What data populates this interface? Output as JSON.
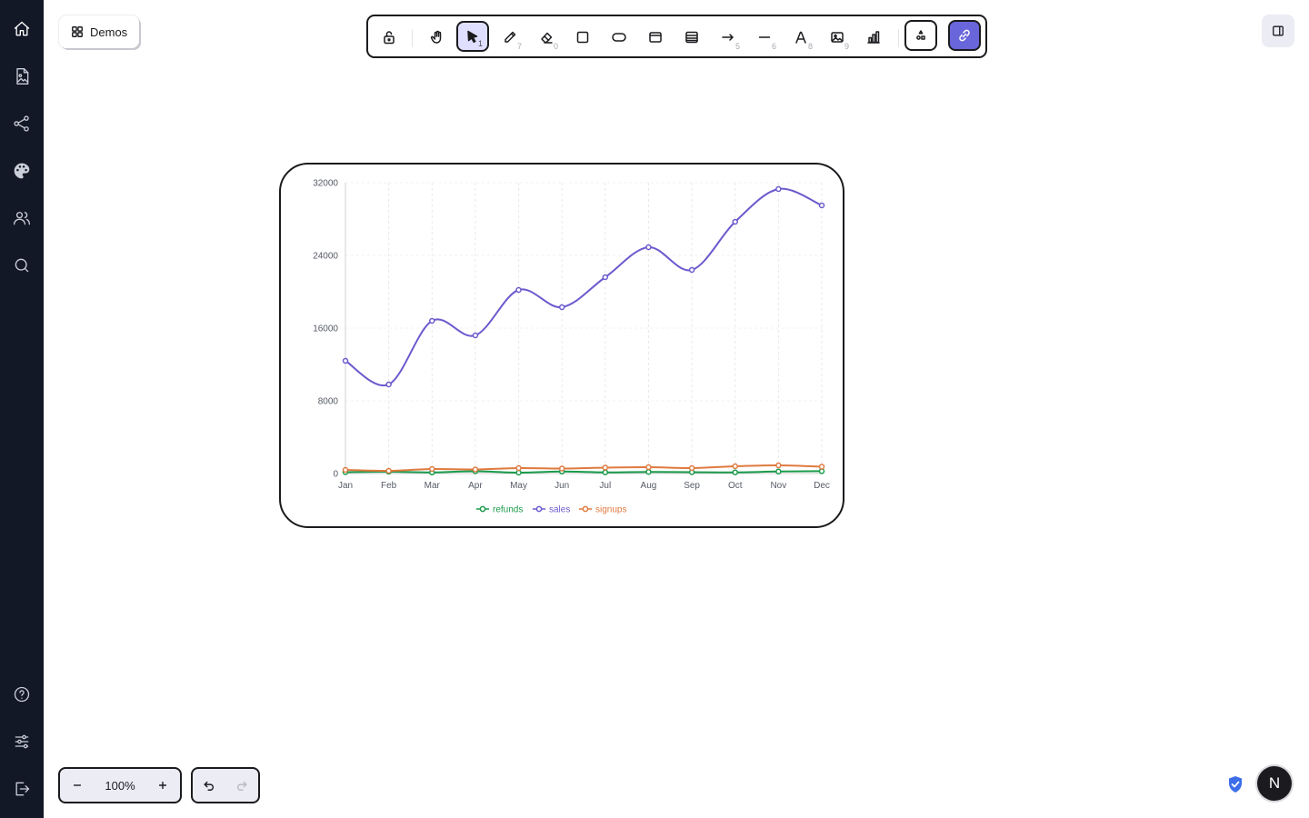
{
  "demos_button": {
    "label": "Demos",
    "icon": "grid-icon"
  },
  "sidebar": {
    "top_items": [
      {
        "name": "home",
        "icon": "home-icon"
      },
      {
        "name": "gallery",
        "icon": "image-file-icon"
      },
      {
        "name": "share",
        "icon": "share-icon"
      },
      {
        "name": "theme",
        "icon": "palette-icon"
      },
      {
        "name": "users",
        "icon": "users-icon"
      },
      {
        "name": "search",
        "icon": "search-icon"
      }
    ],
    "bottom_items": [
      {
        "name": "help",
        "icon": "help-icon"
      },
      {
        "name": "settings",
        "icon": "sliders-icon"
      },
      {
        "name": "logout",
        "icon": "logout-icon"
      }
    ]
  },
  "toolbar": {
    "tools": [
      {
        "name": "lock",
        "icon": "unlock-icon",
        "key": ""
      },
      {
        "name": "hand",
        "icon": "hand-icon",
        "key": ""
      },
      {
        "name": "selection",
        "icon": "pointer-icon",
        "key": "1",
        "active": true
      },
      {
        "name": "pencil",
        "icon": "pencil-icon",
        "key": "7"
      },
      {
        "name": "eraser",
        "icon": "eraser-icon",
        "key": "0"
      },
      {
        "name": "rectangle",
        "icon": "rectangle-icon",
        "key": ""
      },
      {
        "name": "ellipse",
        "icon": "pill-icon",
        "key": ""
      },
      {
        "name": "frame",
        "icon": "frame-icon",
        "key": ""
      },
      {
        "name": "table",
        "icon": "table-icon",
        "key": ""
      },
      {
        "name": "arrow",
        "icon": "arrow-right-icon",
        "key": "5"
      },
      {
        "name": "line",
        "icon": "line-icon",
        "key": "6"
      },
      {
        "name": "text",
        "icon": "text-icon",
        "key": "8"
      },
      {
        "name": "image",
        "icon": "image-icon",
        "key": "9"
      },
      {
        "name": "chart",
        "icon": "bar-chart-icon",
        "key": ""
      },
      {
        "name": "shapes-library",
        "icon": "shapes-icon",
        "key": ""
      },
      {
        "name": "link",
        "icon": "link-icon",
        "key": ""
      }
    ]
  },
  "zoom": {
    "value": "100%"
  },
  "avatar": {
    "initial": "N"
  },
  "colors": {
    "accent": "#6965db",
    "refunds": "#1a9a4a",
    "sales": "#6a5acd",
    "signups": "#e07a3f"
  },
  "chart_data": {
    "type": "line",
    "categories": [
      "Jan",
      "Feb",
      "Mar",
      "Apr",
      "May",
      "Jun",
      "Jul",
      "Aug",
      "Sep",
      "Oct",
      "Nov",
      "Dec"
    ],
    "series": [
      {
        "name": "refunds",
        "color": "#1a9a4a",
        "values": [
          150,
          200,
          120,
          250,
          100,
          220,
          130,
          180,
          150,
          130,
          220,
          260
        ]
      },
      {
        "name": "sales",
        "color": "#6a5acd",
        "values": [
          12400,
          9800,
          16800,
          15200,
          20200,
          18300,
          21600,
          24900,
          22400,
          27700,
          31300,
          29500
        ]
      },
      {
        "name": "signups",
        "color": "#e07a3f",
        "values": [
          400,
          300,
          500,
          450,
          600,
          550,
          650,
          700,
          600,
          800,
          900,
          750
        ]
      }
    ],
    "yticks": [
      0,
      8000,
      16000,
      24000,
      32000
    ],
    "ylim": [
      0,
      32000
    ],
    "grid": true,
    "legend": "bottom"
  }
}
